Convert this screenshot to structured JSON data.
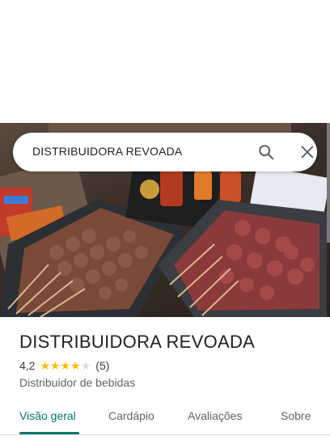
{
  "search": {
    "query": "DISTRIBUIDORA REVOADA",
    "search_icon": "search-icon",
    "clear_icon": "close-icon"
  },
  "place": {
    "name": "DISTRIBUIDORA REVOADA",
    "rating": "4,2",
    "stars_filled": 4,
    "stars_total": 5,
    "review_count": "(5)",
    "category": "Distribuidor de bebidas"
  },
  "tabs": [
    {
      "label": "Visão geral"
    },
    {
      "label": "Cardápio"
    },
    {
      "label": "Avaliações"
    },
    {
      "label": "Sobre"
    }
  ],
  "colors": {
    "accent": "#00796b",
    "star": "#fbbc04",
    "star_empty": "#dadce0"
  }
}
